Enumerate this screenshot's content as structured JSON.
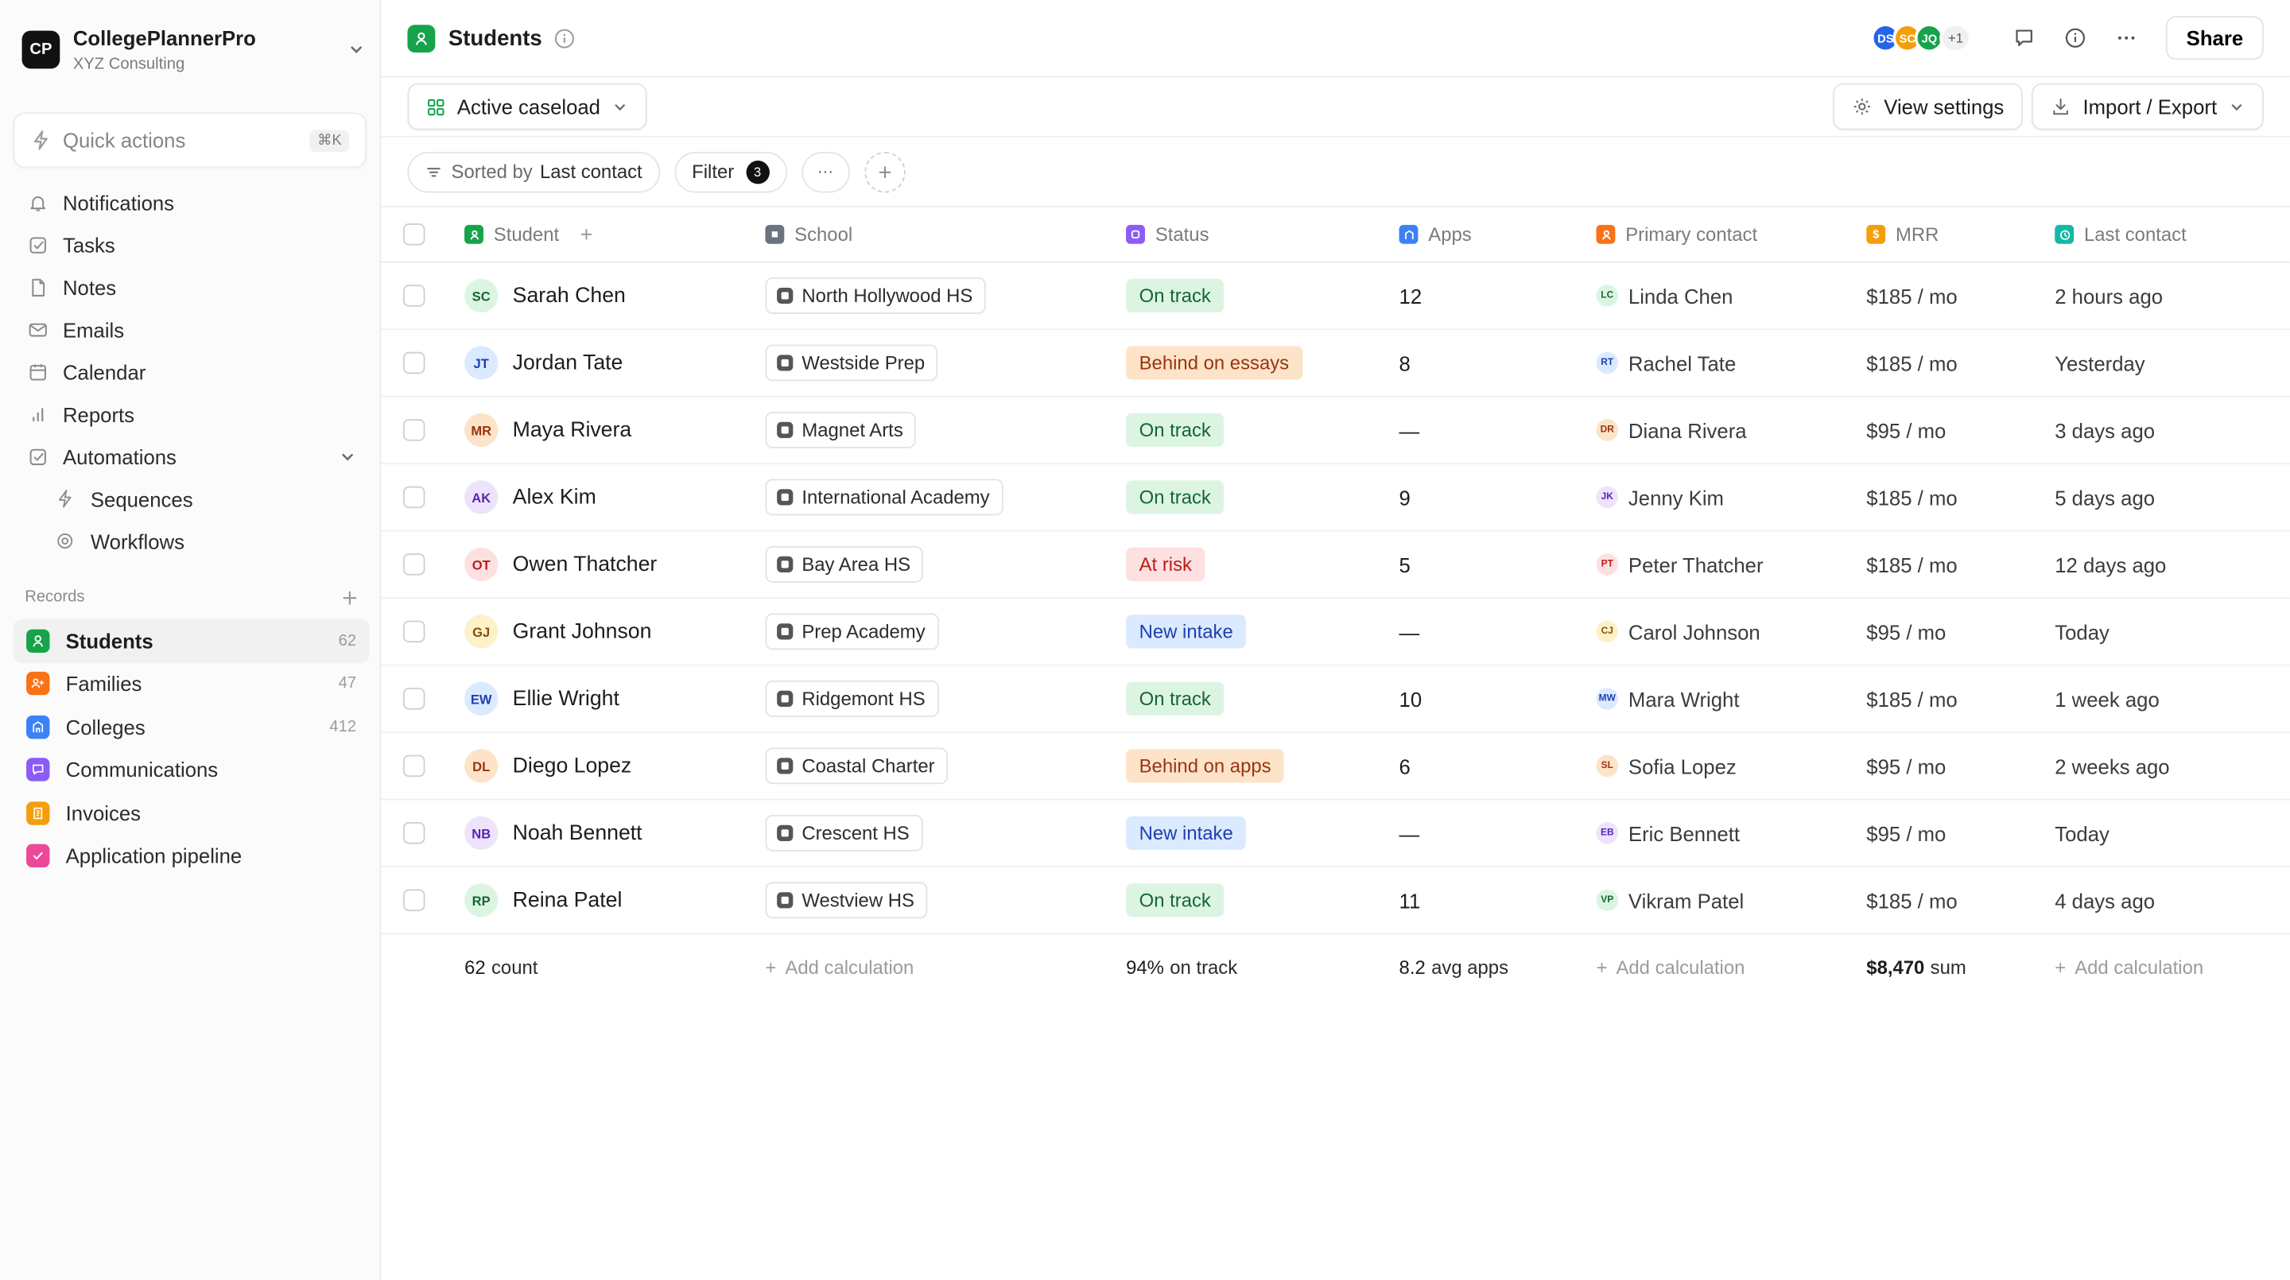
{
  "workspace": {
    "initials": "CP",
    "name": "CollegePlannerPro",
    "subtitle": "XYZ Consulting"
  },
  "quick_actions": {
    "label": "Quick actions",
    "shortcut": "⌘K"
  },
  "nav": [
    {
      "label": "Notifications",
      "icon": "bell-icon"
    },
    {
      "label": "Tasks",
      "icon": "check-square-icon"
    },
    {
      "label": "Notes",
      "icon": "file-icon"
    },
    {
      "label": "Emails",
      "icon": "mail-icon"
    },
    {
      "label": "Calendar",
      "icon": "calendar-icon"
    },
    {
      "label": "Reports",
      "icon": "bar-chart-icon"
    },
    {
      "label": "Automations",
      "icon": "check-square-icon"
    },
    {
      "label": "Sequences",
      "icon": "bolt-icon"
    },
    {
      "label": "Workflows",
      "icon": "target-icon"
    }
  ],
  "records": {
    "heading": "Records",
    "items": [
      {
        "label": "Students",
        "count": "62",
        "color": "#16a34a"
      },
      {
        "label": "Families",
        "count": "47",
        "color": "#f97316"
      },
      {
        "label": "Colleges",
        "count": "412",
        "color": "#3b82f6"
      },
      {
        "label": "Communications",
        "count": "",
        "color": "#8b5cf6"
      },
      {
        "label": "Invoices",
        "count": "",
        "color": "#f59e0b"
      },
      {
        "label": "Application pipeline",
        "count": "",
        "color": "#ec4899"
      }
    ]
  },
  "topbar": {
    "title": "Students",
    "avatars": [
      {
        "initials": "DS",
        "color": "#2563eb"
      },
      {
        "initials": "SC",
        "color": "#f59e0b"
      },
      {
        "initials": "JQ",
        "color": "#16a34a"
      }
    ],
    "avatars_more": "+1",
    "share_label": "Share"
  },
  "viewbar": {
    "view_name": "Active caseload",
    "settings_label": "View settings",
    "import_label": "Import / Export"
  },
  "filterbar": {
    "sorted_prefix": "Sorted by",
    "sorted_field": "Last contact",
    "filter_label": "Filter",
    "filter_count": "3",
    "more_label": "···"
  },
  "columns": {
    "student": "Student",
    "school": "School",
    "status": "Status",
    "apps": "Apps",
    "contact": "Primary contact",
    "mrr": "MRR",
    "last": "Last contact"
  },
  "column_colors": {
    "student": "#16a34a",
    "school": "#6b7280",
    "status": "#8b5cf6",
    "apps": "#3b82f6",
    "contact": "#f97316",
    "mrr": "#f59e0b",
    "last": "#14b8a6"
  },
  "status_styles": {
    "On track": {
      "bg": "#dcf5e3",
      "fg": "#166534"
    },
    "Behind on essays": {
      "bg": "#fde3c8",
      "fg": "#9a3412"
    },
    "Behind on apps": {
      "bg": "#fde3c8",
      "fg": "#9a3412"
    },
    "At risk": {
      "bg": "#fde0e0",
      "fg": "#b91c1c"
    },
    "New intake": {
      "bg": "#dbeafe",
      "fg": "#1e40af"
    }
  },
  "rows": [
    {
      "initials": "SC",
      "name": "Sarah Chen",
      "school": "North Hollywood HS",
      "status": "On track",
      "apps": "12",
      "contact_initials": "LC",
      "contact": "Linda Chen",
      "mrr": "$185 / mo",
      "last": "2 hours ago",
      "av_bg": "#dcf5e3",
      "av_fg": "#166534"
    },
    {
      "initials": "JT",
      "name": "Jordan Tate",
      "school": "Westside Prep",
      "status": "Behind on essays",
      "apps": "8",
      "contact_initials": "RT",
      "contact": "Rachel Tate",
      "mrr": "$185 / mo",
      "last": "Yesterday",
      "av_bg": "#dbeafe",
      "av_fg": "#1e40af"
    },
    {
      "initials": "MR",
      "name": "Maya Rivera",
      "school": "Magnet Arts",
      "status": "On track",
      "apps": "—",
      "contact_initials": "DR",
      "contact": "Diana Rivera",
      "mrr": "$95 / mo",
      "last": "3 days ago",
      "av_bg": "#fde3c8",
      "av_fg": "#9a3412"
    },
    {
      "initials": "AK",
      "name": "Alex Kim",
      "school": "International Academy",
      "status": "On track",
      "apps": "9",
      "contact_initials": "JK",
      "contact": "Jenny Kim",
      "mrr": "$185 / mo",
      "last": "5 days ago",
      "av_bg": "#ede4fb",
      "av_fg": "#5b21b6"
    },
    {
      "initials": "OT",
      "name": "Owen Thatcher",
      "school": "Bay Area HS",
      "status": "At risk",
      "apps": "5",
      "contact_initials": "PT",
      "contact": "Peter Thatcher",
      "mrr": "$185 / mo",
      "last": "12 days ago",
      "av_bg": "#fde0e0",
      "av_fg": "#b91c1c"
    },
    {
      "initials": "GJ",
      "name": "Grant Johnson",
      "school": "Prep Academy",
      "status": "New intake",
      "apps": "—",
      "contact_initials": "CJ",
      "contact": "Carol Johnson",
      "mrr": "$95 / mo",
      "last": "Today",
      "av_bg": "#fdf1c7",
      "av_fg": "#854d0e"
    },
    {
      "initials": "EW",
      "name": "Ellie Wright",
      "school": "Ridgemont HS",
      "status": "On track",
      "apps": "10",
      "contact_initials": "MW",
      "contact": "Mara Wright",
      "mrr": "$185 / mo",
      "last": "1 week ago",
      "av_bg": "#dbeafe",
      "av_fg": "#1e40af"
    },
    {
      "initials": "DL",
      "name": "Diego Lopez",
      "school": "Coastal Charter",
      "status": "Behind on apps",
      "apps": "6",
      "contact_initials": "SL",
      "contact": "Sofia Lopez",
      "mrr": "$95 / mo",
      "last": "2 weeks ago",
      "av_bg": "#fde3c8",
      "av_fg": "#9a3412"
    },
    {
      "initials": "NB",
      "name": "Noah Bennett",
      "school": "Crescent HS",
      "status": "New intake",
      "apps": "—",
      "contact_initials": "EB",
      "contact": "Eric Bennett",
      "mrr": "$95 / mo",
      "last": "Today",
      "av_bg": "#ede4fb",
      "av_fg": "#5b21b6"
    },
    {
      "initials": "RP",
      "name": "Reina Patel",
      "school": "Westview HS",
      "status": "On track",
      "apps": "11",
      "contact_initials": "VP",
      "contact": "Vikram Patel",
      "mrr": "$185 / mo",
      "last": "4 days ago",
      "av_bg": "#dcf5e3",
      "av_fg": "#166534"
    }
  ],
  "footer": {
    "count": "62",
    "count_label": "count",
    "add_calc": "Add calculation",
    "status_value": "94%",
    "status_label": "on track",
    "apps_value": "8.2",
    "apps_label": "avg apps",
    "mrr_value": "$8,470",
    "mrr_label": "sum"
  }
}
